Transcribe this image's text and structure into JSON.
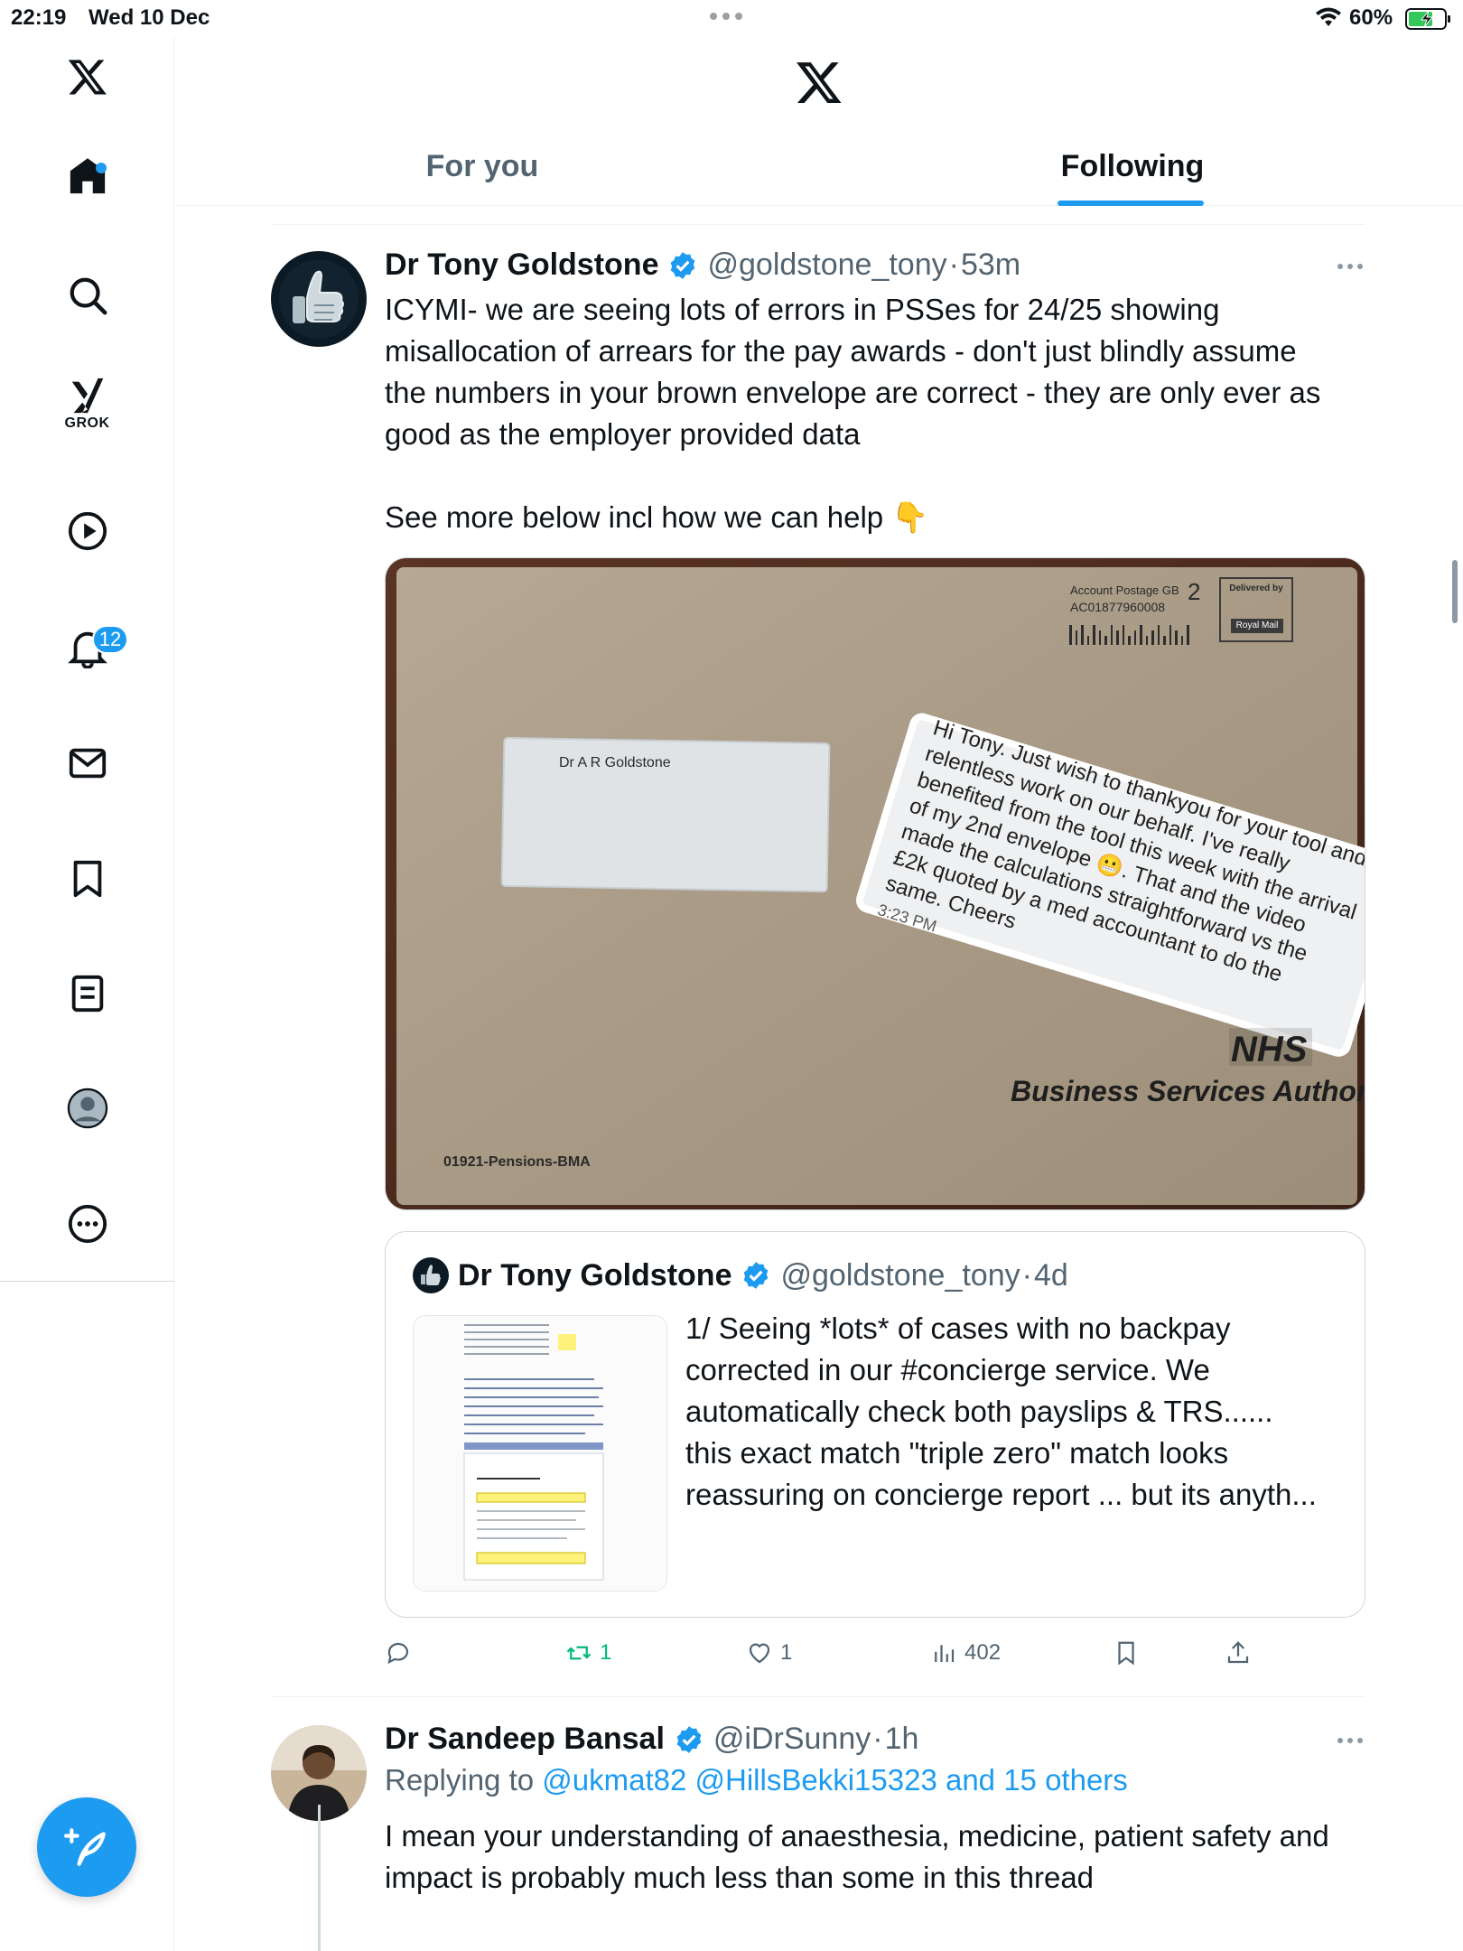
{
  "status_bar": {
    "time": "22:19",
    "date": "Wed 10 Dec",
    "battery": "60%"
  },
  "sidebar": {
    "grok_label": "GROK",
    "notifications_count": "12"
  },
  "tabs": {
    "for_you": "For you",
    "following": "Following"
  },
  "tweet1": {
    "name": "Dr Tony Goldstone",
    "handle": "@goldstone_tony",
    "dot": "·",
    "time": "53m",
    "text_lines": [
      "ICYMI- we are seeing lots of errors in PSSes for 24/25 showing",
      "misallocation of arrears for the pay awards - don't just blindly assume",
      "the numbers in your brown envelope are correct - they are only ever as",
      "good as the employer provided data"
    ],
    "text2": "See more below incl how we can help 👇",
    "media": {
      "account_postage": "Account Postage GB",
      "account_number": "AC01877960008",
      "class_number": "2",
      "delivered_by": "Delivered by",
      "royal_mail": "Royal Mail",
      "window_name": "Dr A R Goldstone",
      "nhs": "NHS",
      "bsa": "Business Services Authority",
      "envelope_ref": "01921-Pensions-BMA",
      "message_lines": [
        "Hi Tony. Just wish to thankyou for your tool and",
        "relentless work on our behalf. I've really",
        "benefited from the tool this week with the arrival",
        "of my 2nd envelope 😬. That and the video",
        "made the calculations straightforward vs the",
        "£2k quoted by a med accountant to do the",
        "same. Cheers"
      ],
      "message_time": "3:23 PM"
    },
    "quote": {
      "name": "Dr Tony Goldstone",
      "handle": "@goldstone_tony",
      "dot": "·",
      "time": "4d",
      "text_lines": [
        "1/ Seeing *lots* of cases with no backpay",
        "corrected in our #concierge service. We",
        "automatically check both  payslips & TRS......",
        "this exact match \"triple zero\" match looks",
        "reassuring on concierge report ... but its anyth..."
      ]
    },
    "actions": {
      "reposts": "1",
      "likes": "1",
      "views": "402"
    }
  },
  "tweet2": {
    "name": "Dr Sandeep Bansal",
    "handle": "@iDrSunny",
    "dot": "·",
    "time": "1h",
    "replying_to_label": "Replying to",
    "replying_to_users": "@ukmat82 @HillsBekki15323 and 15 others",
    "text_lines": [
      "I mean your understanding of anaesthesia, medicine, patient safety and",
      "impact is probably much less than some in this thread"
    ]
  },
  "colors": {
    "accent": "#1d9bf0",
    "text": "#0f1419",
    "secondary": "#536471",
    "repost_green": "#00ba7c"
  },
  "icons": [
    "x-logo-icon",
    "home-icon",
    "search-icon",
    "grok-icon",
    "video-icon",
    "bell-icon",
    "mail-icon",
    "bookmark-icon",
    "list-icon",
    "profile-icon",
    "more-icon",
    "compose-icon",
    "verified-icon",
    "reply-icon",
    "repost-icon",
    "like-icon",
    "views-icon",
    "bookmark-icon",
    "share-icon",
    "wifi-icon",
    "battery-icon"
  ]
}
